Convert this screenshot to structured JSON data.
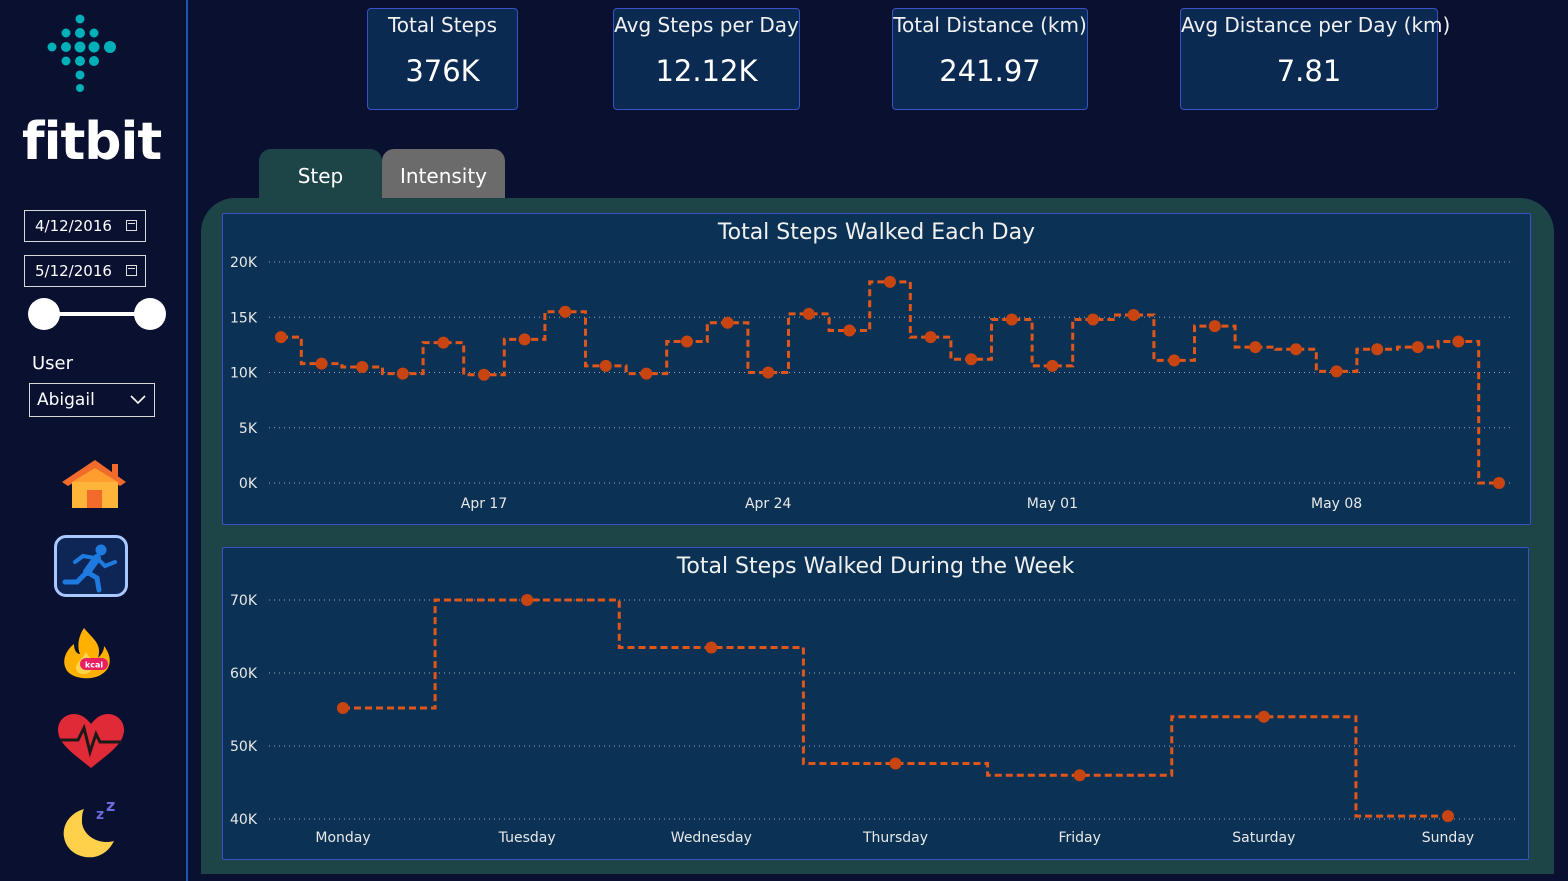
{
  "sidebar": {
    "brand": "fitbit",
    "date_start": "4/12/2016",
    "date_end": "5/12/2016",
    "user_label": "User",
    "user_value": "Abigail",
    "nav_icons": [
      "home-icon",
      "running-icon",
      "calories-flame-icon",
      "heart-rate-icon",
      "sleep-moon-icon"
    ],
    "calorie_badge": "kcal"
  },
  "kpis": [
    {
      "title": "Total Steps",
      "value": "376K"
    },
    {
      "title": "Avg Steps per Day",
      "value": "12.12K"
    },
    {
      "title": "Total Distance (km)",
      "value": "241.97"
    },
    {
      "title": "Avg Distance per Day (km)",
      "value": "7.81"
    }
  ],
  "tabs": [
    {
      "label": "Step",
      "active": true
    },
    {
      "label": "Intensity",
      "active": false
    }
  ],
  "colors": {
    "accent": "#e0561a",
    "panel": "#1d4446",
    "chart_bg": "#0b3254",
    "border": "#3a52c8"
  },
  "chart_data": [
    {
      "type": "line",
      "step": true,
      "title": "Total Steps Walked Each Day",
      "x_ticks": [
        "Apr 17",
        "Apr 24",
        "May 01",
        "May 08"
      ],
      "y_ticks": [
        "0K",
        "5K",
        "10K",
        "15K",
        "20K"
      ],
      "ylim": [
        0,
        20000
      ],
      "x_start": "2016-04-12",
      "dates": [
        "2016-04-12",
        "2016-04-13",
        "2016-04-14",
        "2016-04-15",
        "2016-04-16",
        "2016-04-17",
        "2016-04-18",
        "2016-04-19",
        "2016-04-20",
        "2016-04-21",
        "2016-04-22",
        "2016-04-23",
        "2016-04-24",
        "2016-04-25",
        "2016-04-26",
        "2016-04-27",
        "2016-04-28",
        "2016-04-29",
        "2016-04-30",
        "2016-05-01",
        "2016-05-02",
        "2016-05-03",
        "2016-05-04",
        "2016-05-05",
        "2016-05-06",
        "2016-05-07",
        "2016-05-08",
        "2016-05-09",
        "2016-05-10",
        "2016-05-11",
        "2016-05-12"
      ],
      "values": [
        13200,
        10800,
        10500,
        9900,
        12700,
        9800,
        13000,
        15500,
        10600,
        9900,
        12800,
        14500,
        10000,
        15300,
        13800,
        18200,
        13200,
        11200,
        14800,
        10600,
        14800,
        15200,
        11100,
        14200,
        12300,
        12100,
        10100,
        12100,
        12300,
        12800,
        0
      ],
      "grid": true
    },
    {
      "type": "line",
      "step": true,
      "title": "Total Steps Walked During the Week",
      "categories": [
        "Monday",
        "Tuesday",
        "Wednesday",
        "Thursday",
        "Friday",
        "Saturday",
        "Sunday"
      ],
      "y_ticks": [
        "40K",
        "50K",
        "60K",
        "70K"
      ],
      "ylim": [
        40000,
        70000
      ],
      "values": [
        55200,
        70000,
        63500,
        47600,
        46000,
        54000,
        40400
      ],
      "grid": true
    }
  ]
}
